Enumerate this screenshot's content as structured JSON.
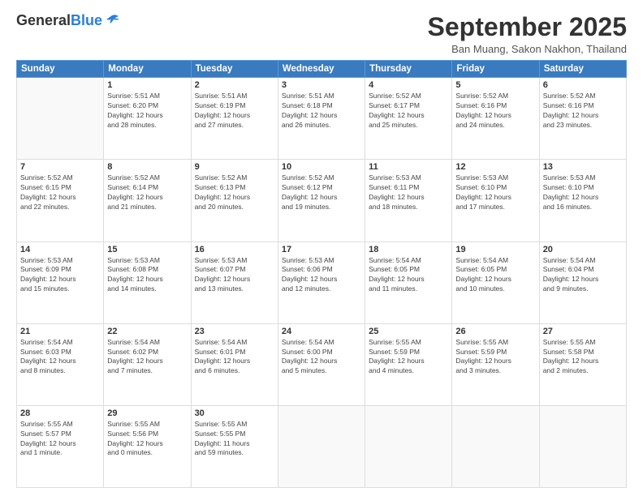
{
  "header": {
    "logo_general": "General",
    "logo_blue": "Blue",
    "month_title": "September 2025",
    "location": "Ban Muang, Sakon Nakhon, Thailand"
  },
  "weekdays": [
    "Sunday",
    "Monday",
    "Tuesday",
    "Wednesday",
    "Thursday",
    "Friday",
    "Saturday"
  ],
  "weeks": [
    [
      {
        "day": "",
        "info": ""
      },
      {
        "day": "1",
        "info": "Sunrise: 5:51 AM\nSunset: 6:20 PM\nDaylight: 12 hours\nand 28 minutes."
      },
      {
        "day": "2",
        "info": "Sunrise: 5:51 AM\nSunset: 6:19 PM\nDaylight: 12 hours\nand 27 minutes."
      },
      {
        "day": "3",
        "info": "Sunrise: 5:51 AM\nSunset: 6:18 PM\nDaylight: 12 hours\nand 26 minutes."
      },
      {
        "day": "4",
        "info": "Sunrise: 5:52 AM\nSunset: 6:17 PM\nDaylight: 12 hours\nand 25 minutes."
      },
      {
        "day": "5",
        "info": "Sunrise: 5:52 AM\nSunset: 6:16 PM\nDaylight: 12 hours\nand 24 minutes."
      },
      {
        "day": "6",
        "info": "Sunrise: 5:52 AM\nSunset: 6:16 PM\nDaylight: 12 hours\nand 23 minutes."
      }
    ],
    [
      {
        "day": "7",
        "info": "Sunrise: 5:52 AM\nSunset: 6:15 PM\nDaylight: 12 hours\nand 22 minutes."
      },
      {
        "day": "8",
        "info": "Sunrise: 5:52 AM\nSunset: 6:14 PM\nDaylight: 12 hours\nand 21 minutes."
      },
      {
        "day": "9",
        "info": "Sunrise: 5:52 AM\nSunset: 6:13 PM\nDaylight: 12 hours\nand 20 minutes."
      },
      {
        "day": "10",
        "info": "Sunrise: 5:52 AM\nSunset: 6:12 PM\nDaylight: 12 hours\nand 19 minutes."
      },
      {
        "day": "11",
        "info": "Sunrise: 5:53 AM\nSunset: 6:11 PM\nDaylight: 12 hours\nand 18 minutes."
      },
      {
        "day": "12",
        "info": "Sunrise: 5:53 AM\nSunset: 6:10 PM\nDaylight: 12 hours\nand 17 minutes."
      },
      {
        "day": "13",
        "info": "Sunrise: 5:53 AM\nSunset: 6:10 PM\nDaylight: 12 hours\nand 16 minutes."
      }
    ],
    [
      {
        "day": "14",
        "info": "Sunrise: 5:53 AM\nSunset: 6:09 PM\nDaylight: 12 hours\nand 15 minutes."
      },
      {
        "day": "15",
        "info": "Sunrise: 5:53 AM\nSunset: 6:08 PM\nDaylight: 12 hours\nand 14 minutes."
      },
      {
        "day": "16",
        "info": "Sunrise: 5:53 AM\nSunset: 6:07 PM\nDaylight: 12 hours\nand 13 minutes."
      },
      {
        "day": "17",
        "info": "Sunrise: 5:53 AM\nSunset: 6:06 PM\nDaylight: 12 hours\nand 12 minutes."
      },
      {
        "day": "18",
        "info": "Sunrise: 5:54 AM\nSunset: 6:05 PM\nDaylight: 12 hours\nand 11 minutes."
      },
      {
        "day": "19",
        "info": "Sunrise: 5:54 AM\nSunset: 6:05 PM\nDaylight: 12 hours\nand 10 minutes."
      },
      {
        "day": "20",
        "info": "Sunrise: 5:54 AM\nSunset: 6:04 PM\nDaylight: 12 hours\nand 9 minutes."
      }
    ],
    [
      {
        "day": "21",
        "info": "Sunrise: 5:54 AM\nSunset: 6:03 PM\nDaylight: 12 hours\nand 8 minutes."
      },
      {
        "day": "22",
        "info": "Sunrise: 5:54 AM\nSunset: 6:02 PM\nDaylight: 12 hours\nand 7 minutes."
      },
      {
        "day": "23",
        "info": "Sunrise: 5:54 AM\nSunset: 6:01 PM\nDaylight: 12 hours\nand 6 minutes."
      },
      {
        "day": "24",
        "info": "Sunrise: 5:54 AM\nSunset: 6:00 PM\nDaylight: 12 hours\nand 5 minutes."
      },
      {
        "day": "25",
        "info": "Sunrise: 5:55 AM\nSunset: 5:59 PM\nDaylight: 12 hours\nand 4 minutes."
      },
      {
        "day": "26",
        "info": "Sunrise: 5:55 AM\nSunset: 5:59 PM\nDaylight: 12 hours\nand 3 minutes."
      },
      {
        "day": "27",
        "info": "Sunrise: 5:55 AM\nSunset: 5:58 PM\nDaylight: 12 hours\nand 2 minutes."
      }
    ],
    [
      {
        "day": "28",
        "info": "Sunrise: 5:55 AM\nSunset: 5:57 PM\nDaylight: 12 hours\nand 1 minute."
      },
      {
        "day": "29",
        "info": "Sunrise: 5:55 AM\nSunset: 5:56 PM\nDaylight: 12 hours\nand 0 minutes."
      },
      {
        "day": "30",
        "info": "Sunrise: 5:55 AM\nSunset: 5:55 PM\nDaylight: 11 hours\nand 59 minutes."
      },
      {
        "day": "",
        "info": ""
      },
      {
        "day": "",
        "info": ""
      },
      {
        "day": "",
        "info": ""
      },
      {
        "day": "",
        "info": ""
      }
    ]
  ]
}
